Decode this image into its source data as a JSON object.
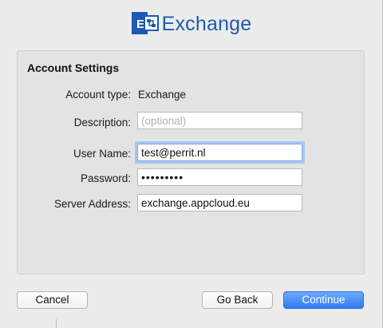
{
  "header": {
    "logo_icon": "exchange-logo-icon",
    "title": "Exchange",
    "brand_color": "#1e5ab4"
  },
  "account_settings": {
    "title": "Account Settings",
    "account_type_label": "Account type:",
    "account_type_value": "Exchange",
    "description_label": "Description:",
    "description_value": "",
    "description_placeholder": "(optional)",
    "user_name_label": "User Name:",
    "user_name_value": "test@perrit.nl",
    "password_label": "Password:",
    "password_display": "•••••••••",
    "server_address_label": "Server Address:",
    "server_address_value": "exchange.appcloud.eu"
  },
  "buttons": {
    "cancel_label": "Cancel",
    "go_back_label": "Go Back",
    "continue_label": "Continue"
  },
  "colors": {
    "focus_ring": "#a9c8f2",
    "primary_button": "#3a86f5"
  }
}
